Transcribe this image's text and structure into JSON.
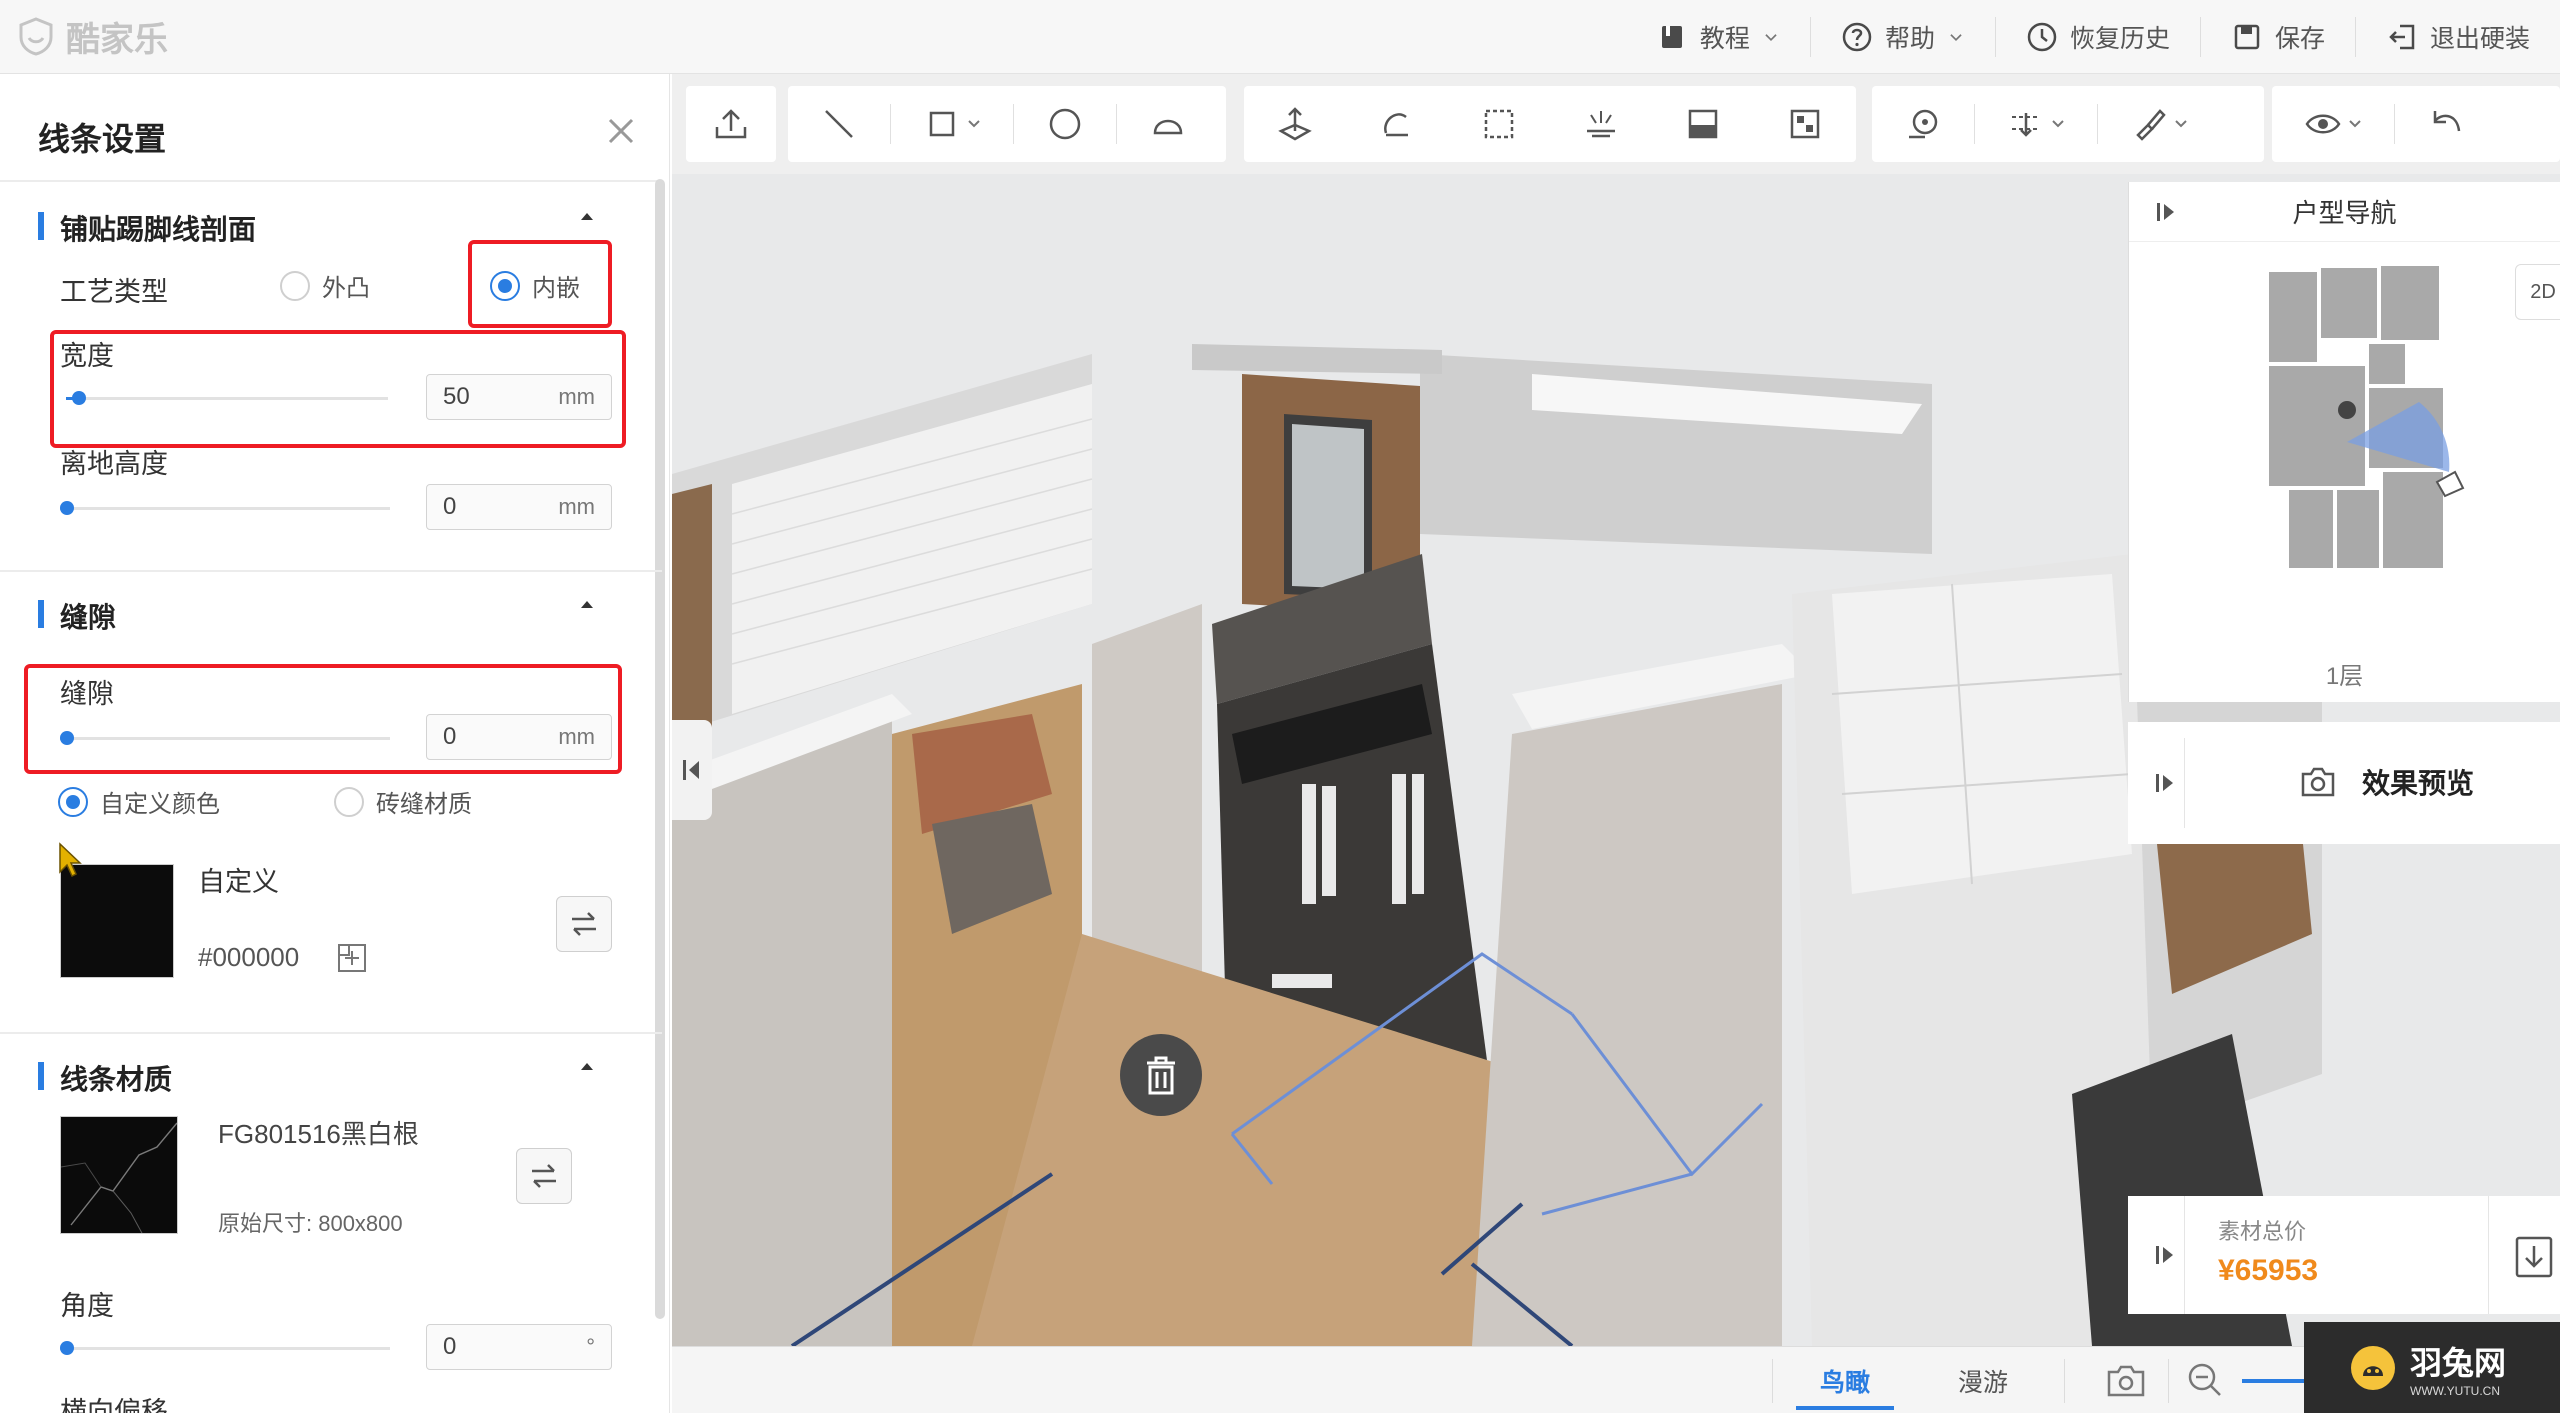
{
  "app": {
    "logo_text": "酷家乐"
  },
  "topmenu": {
    "tutorial": "教程",
    "help": "帮助",
    "history": "恢复历史",
    "save": "保存",
    "exit": "退出硬装"
  },
  "panel": {
    "title": "线条设置",
    "section1": {
      "title": "铺贴踢脚线剖面",
      "craft_label": "工艺类型",
      "option_outer": "外凸",
      "option_inner": "内嵌",
      "selected": "内嵌",
      "width_label": "宽度",
      "width_value": "50",
      "height_label": "离地高度",
      "height_value": "0",
      "unit": "mm"
    },
    "section2": {
      "title": "缝隙",
      "gap_label": "缝隙",
      "gap_value": "0",
      "unit": "mm",
      "option_custom_color": "自定义颜色",
      "option_tile_material": "砖缝材质",
      "selected": "自定义颜色",
      "custom_label": "自定义",
      "color_hex": "#000000",
      "swatch_color": "#0c0c0c"
    },
    "section3": {
      "title": "线条材质",
      "material_name": "FG801516黑白根",
      "material_size": "原始尺寸: 800x800",
      "angle_label": "角度",
      "angle_value": "0",
      "angle_unit": "°",
      "offset_label": "横向偏移"
    }
  },
  "navigator": {
    "title": "户型导航",
    "mode_button": "2D",
    "floor": "1层"
  },
  "preview": {
    "label": "效果预览"
  },
  "price": {
    "label": "素材总价",
    "value": "¥65953"
  },
  "view_tabs": {
    "aerial": "鸟瞰",
    "roam": "漫游",
    "active": "鸟瞰"
  },
  "watermark": {
    "main": "羽兔网",
    "sub": "WWW.YUTU.CN"
  },
  "colors": {
    "accent": "#2a7de1",
    "highlight_box": "#ee1c24",
    "price": "#f08a1c"
  }
}
